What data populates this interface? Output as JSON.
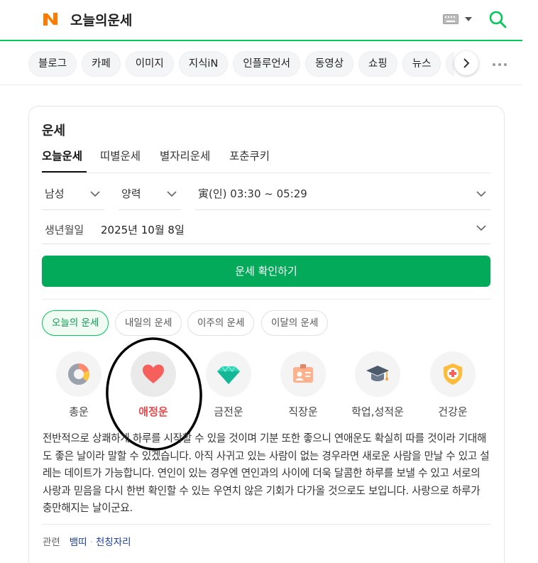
{
  "header": {
    "title": "오늘의운세"
  },
  "categories": [
    "블로그",
    "카페",
    "이미지",
    "지식iN",
    "인플루언서",
    "동영상",
    "쇼핑",
    "뉴스",
    "쇼핑"
  ],
  "card": {
    "title": "운세",
    "tabs": [
      "오늘운세",
      "띠별운세",
      "별자리운세",
      "포춘쿠키"
    ],
    "gender": "남성",
    "calendar": "양력",
    "birth_time": "寅(인) 03:30 ~ 05:29",
    "birth_label": "생년월일",
    "birth_value": "2025년 10월 8일",
    "confirm_label": "운세 확인하기",
    "periods": [
      "오늘의 운세",
      "내일의 운세",
      "이주의 운세",
      "이달의 운세"
    ],
    "fortune_cats": [
      "총운",
      "애정운",
      "금전운",
      "직장운",
      "학업,성적운",
      "건강운"
    ],
    "description": "전반적으로 상쾌하게 하루를 시작할 수 있을 것이며 기분 또한 좋으니 연애운도 확실히 따를 것이라 기대해도 좋은 날이라 말할 수 있겠습니다. 아직 사귀고 있는 사람이 없는 경우라면 새로운 사람을 만날 수 있고 설레는 데이트가 가능합니다. 연인이 있는 경우엔 연인과의 사이에 더욱 달콤한 하루를 보낼 수 있고 서로의 사랑과 믿음을 다시 한번 확인할 수 있는 우연치 않은 기회가 다가올 것으로도 보입니다. 사랑으로 하루가 충만해지는 날이군요.",
    "related_label": "관련",
    "related_links": [
      "뱀띠",
      "천칭자리"
    ]
  },
  "colors": {
    "brand": "#03c75a",
    "button": "#03aa5a",
    "active_label": "#f0474a"
  }
}
